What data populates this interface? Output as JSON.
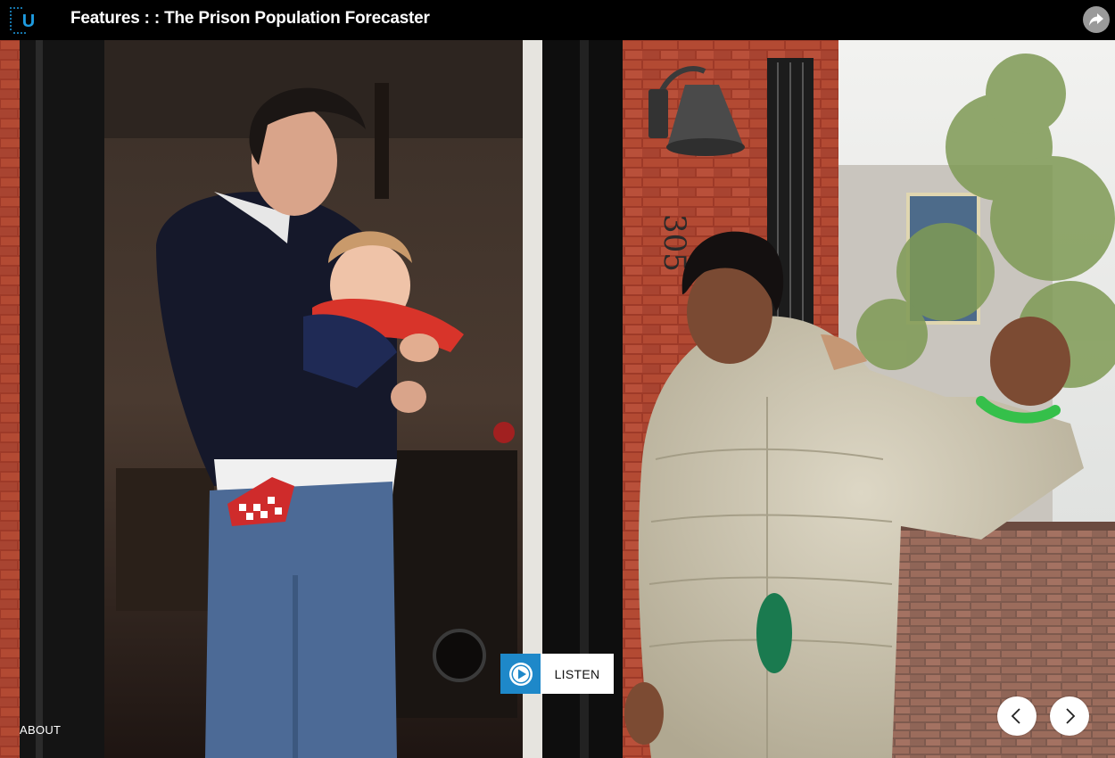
{
  "header": {
    "logo_letter": "U",
    "title": "Features : : The Prison Population Forecaster",
    "share_icon": "share-arrow-icon"
  },
  "photo": {
    "house_number": "305"
  },
  "audio": {
    "listen_label": "LISTEN",
    "play_icon": "play-icon",
    "accent_color": "#1e88c9"
  },
  "footer": {
    "about_label": "ABOUT"
  },
  "navigation": {
    "prev_icon": "chevron-left-icon",
    "next_icon": "chevron-right-icon"
  }
}
